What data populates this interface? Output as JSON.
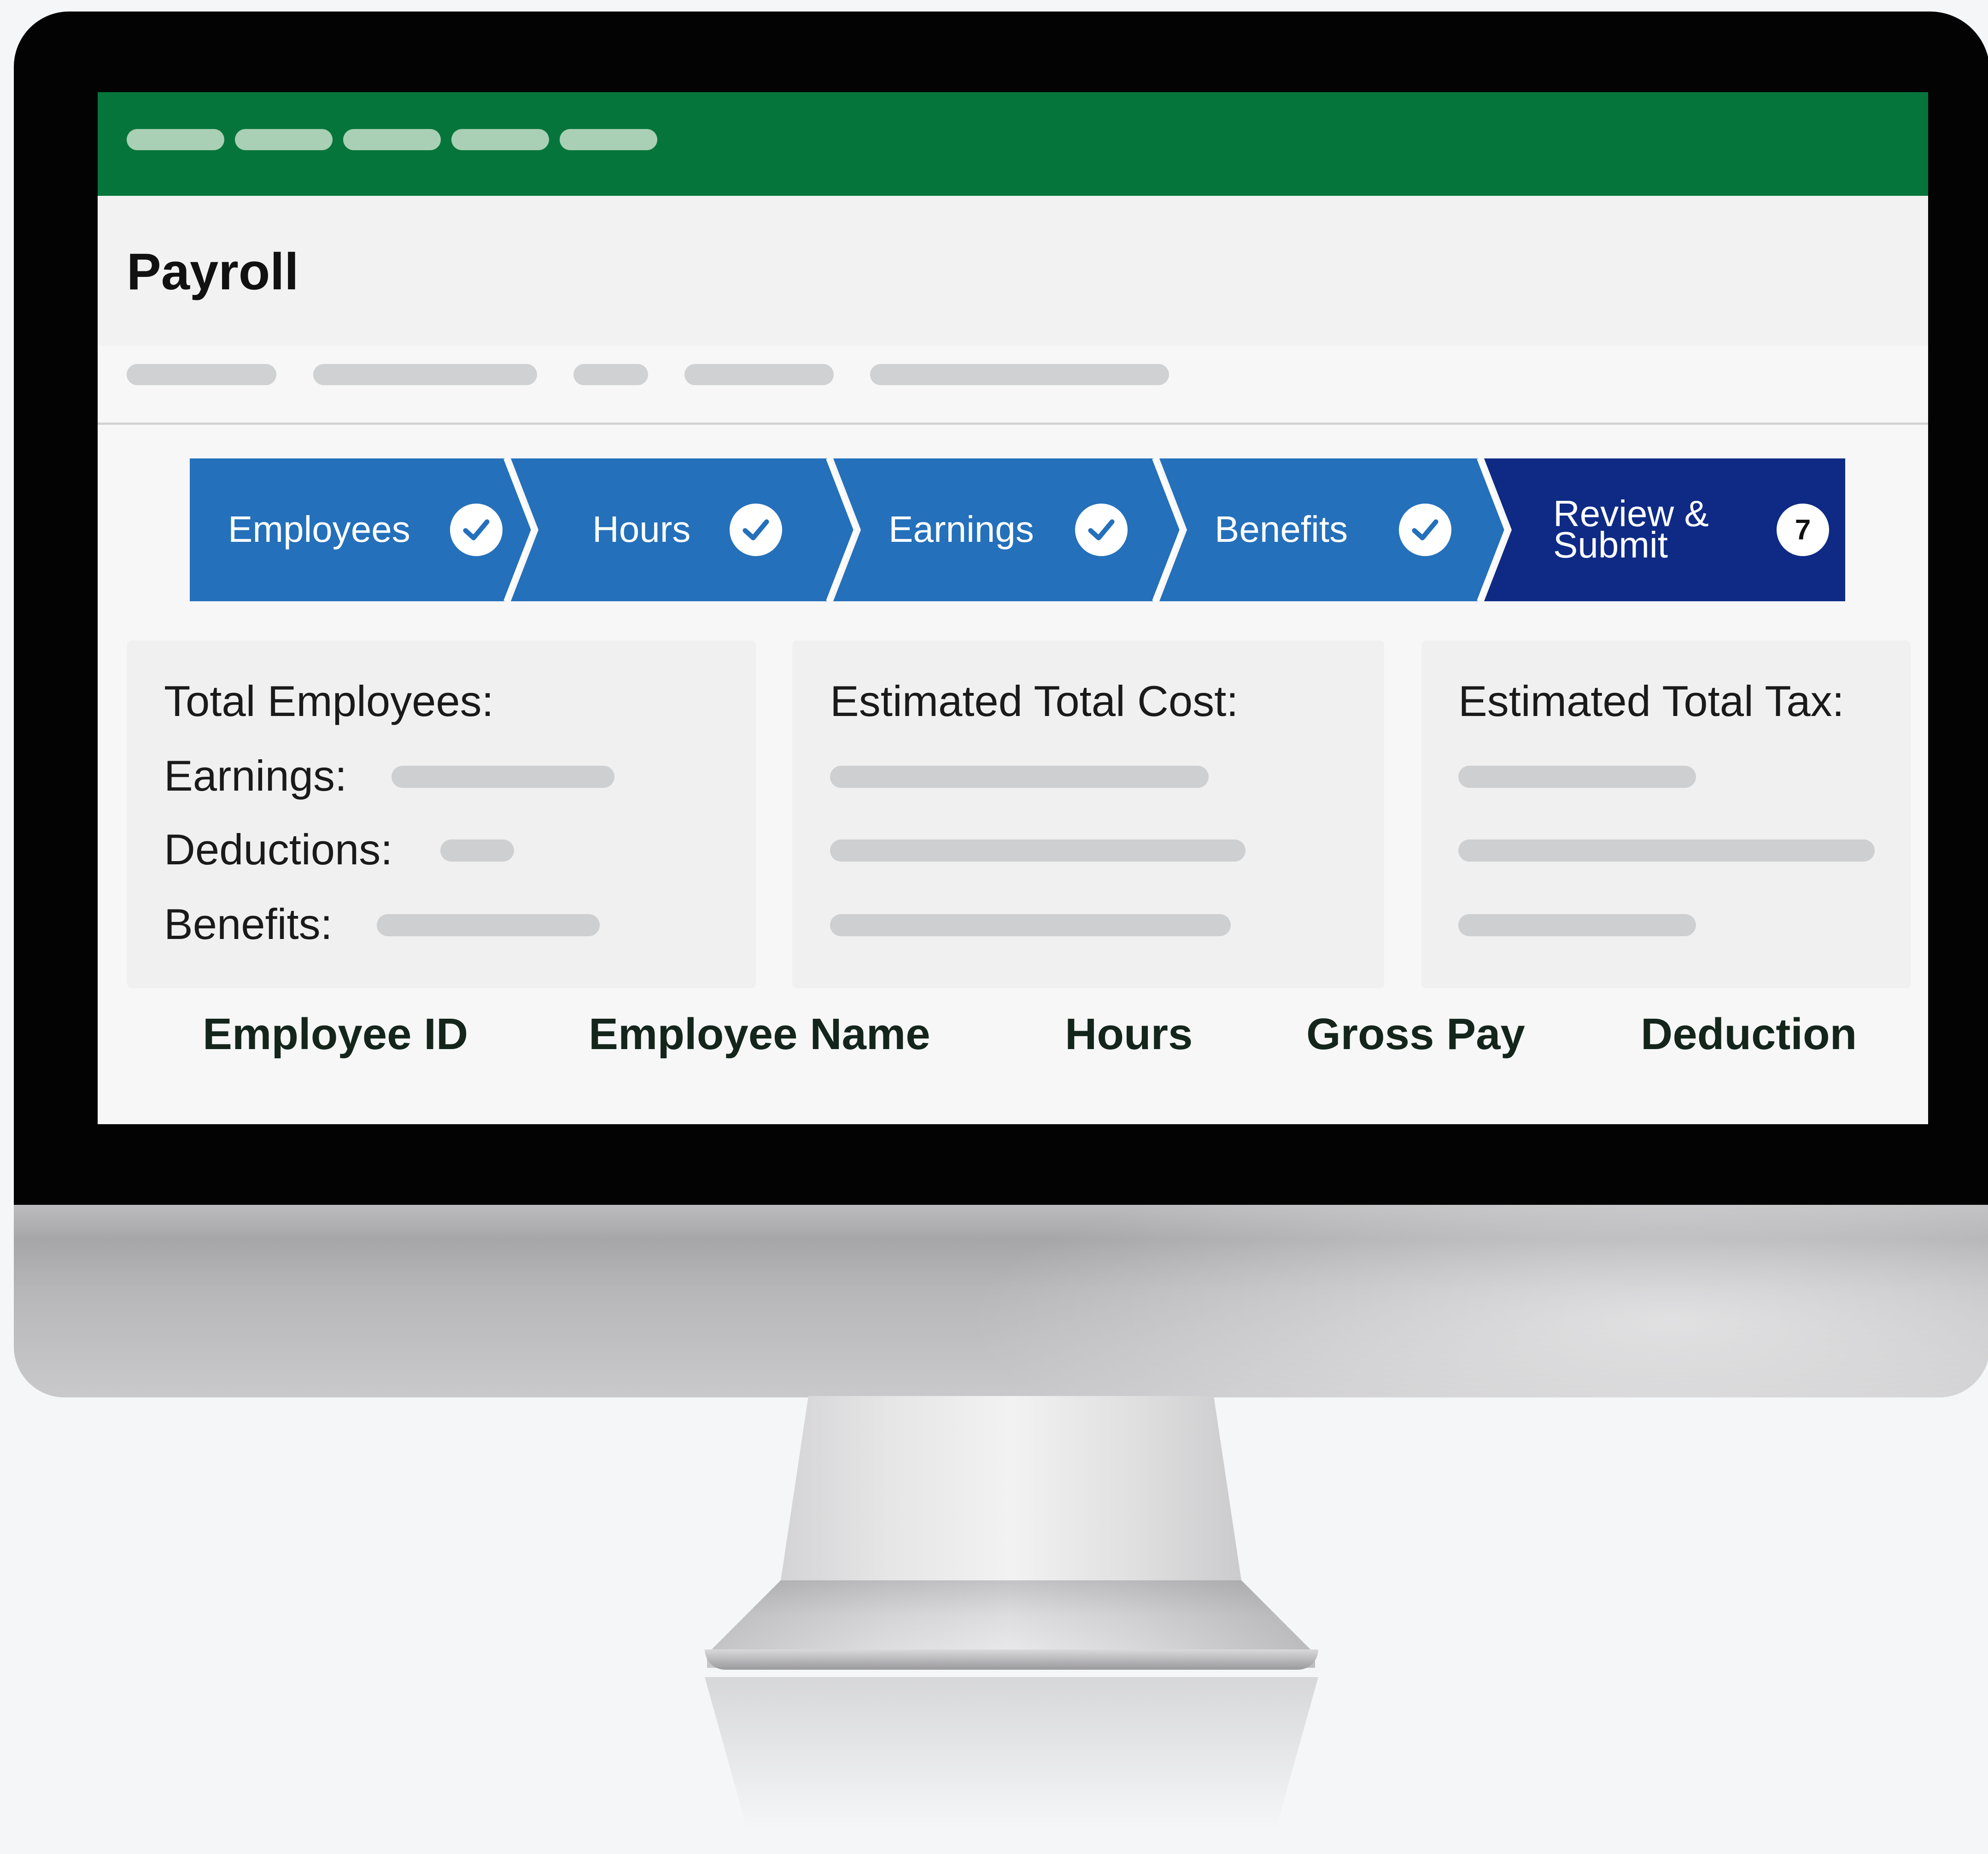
{
  "app": {
    "title": "Payroll"
  },
  "stepper": {
    "steps": [
      {
        "label": "Employees",
        "status": "complete",
        "icon": "check-icon"
      },
      {
        "label": "Hours",
        "status": "complete",
        "icon": "check-icon"
      },
      {
        "label": "Earnings",
        "status": "complete",
        "icon": "check-icon"
      },
      {
        "label": "Benefits",
        "status": "complete",
        "icon": "check-icon"
      },
      {
        "label": "Review &\nSubmit",
        "status": "current",
        "badge": "7"
      }
    ]
  },
  "summary": {
    "employees_card": {
      "total_label": "Total Employees:",
      "earnings_label": "Earnings:",
      "deductions_label": "Deductions:",
      "benefits_label": "Benefits:"
    },
    "cost_card": {
      "label": "Estimated Total Cost:"
    },
    "tax_card": {
      "label": "Estimated Total Tax:"
    }
  },
  "table": {
    "columns": [
      "Employee ID",
      "Employee Name",
      "Hours",
      "Gross Pay",
      "Deduction"
    ]
  },
  "colors": {
    "brand_green": "#06753b",
    "step_blue": "#2470bb",
    "step_current": "#0e2a85",
    "placeholder_gray": "#cdcfd0"
  }
}
